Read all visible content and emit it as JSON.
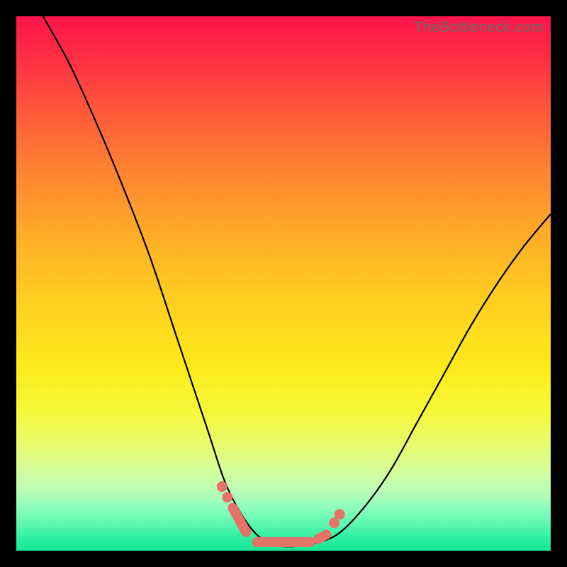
{
  "watermark": "TheBottleneck.com",
  "colors": {
    "frame": "#000000",
    "curve": "#000000",
    "marker": "#e57368"
  },
  "chart_data": {
    "type": "line",
    "title": "",
    "xlabel": "",
    "ylabel": "",
    "xlim": [
      0,
      100
    ],
    "ylim": [
      0,
      100
    ],
    "grid": false,
    "legend": false,
    "series": [
      {
        "name": "bottleneck-curve",
        "x": [
          5,
          10,
          15,
          20,
          25,
          30,
          33,
          36,
          39,
          42,
          45,
          48,
          50,
          52,
          55,
          60,
          65,
          70,
          75,
          80,
          85,
          90,
          95,
          100
        ],
        "y": [
          100,
          91,
          80,
          68,
          55,
          40,
          31,
          22,
          13,
          7,
          3,
          1.2,
          0.8,
          0.8,
          1.2,
          3,
          8,
          15,
          24,
          33,
          42,
          50,
          57,
          63
        ]
      }
    ],
    "markers": [
      {
        "name": "low-region-dot-1",
        "x": 38.5,
        "y": 12
      },
      {
        "name": "low-region-dot-2",
        "x": 39.5,
        "y": 10
      },
      {
        "name": "low-region-seg-1a",
        "x": 40.5,
        "y": 8
      },
      {
        "name": "low-region-seg-1b",
        "x": 43.0,
        "y": 3.5
      },
      {
        "name": "bottom-seg-a",
        "x": 45.0,
        "y": 1.6
      },
      {
        "name": "bottom-seg-b",
        "x": 55.0,
        "y": 1.6
      },
      {
        "name": "up-seg-a",
        "x": 56.5,
        "y": 2.2
      },
      {
        "name": "up-seg-b",
        "x": 58.0,
        "y": 3.0
      },
      {
        "name": "up-dot-1",
        "x": 59.5,
        "y": 5.2
      },
      {
        "name": "up-dot-2",
        "x": 60.5,
        "y": 6.8
      }
    ]
  }
}
